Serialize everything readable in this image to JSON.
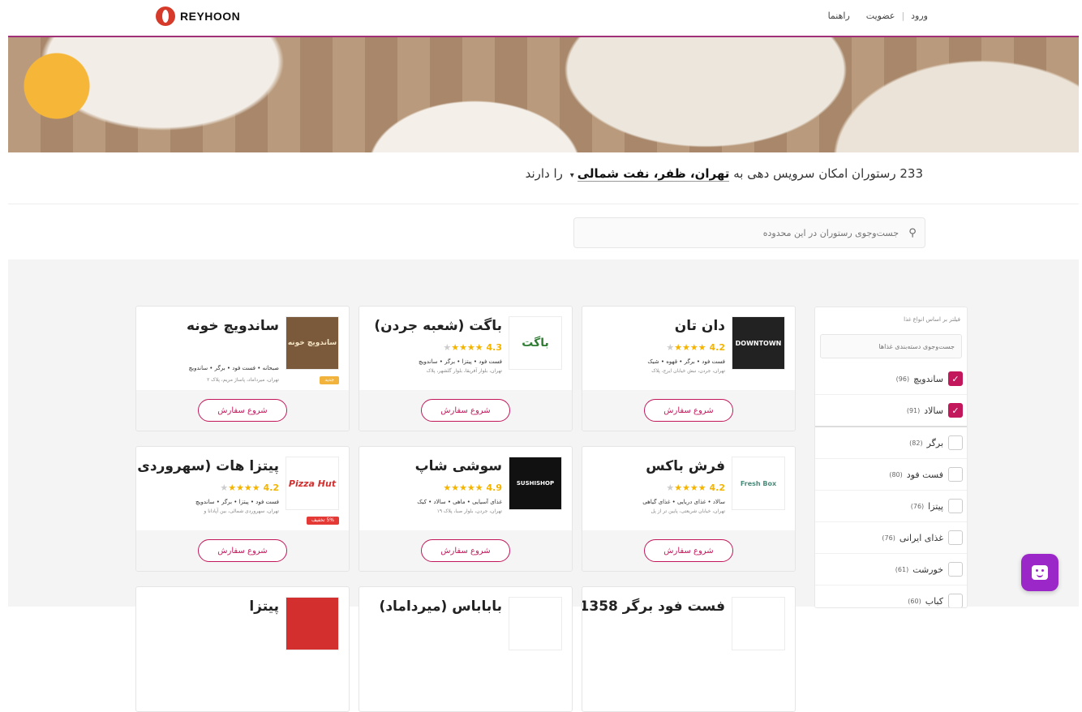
{
  "header": {
    "logo_text": "REYHOON",
    "nav": [
      {
        "label": "ورود"
      },
      {
        "label": "عضویت"
      },
      {
        "label": "راهنما"
      }
    ]
  },
  "summary": {
    "count": "233",
    "prefix": "رستوران امکان سرویس دهی به",
    "location": "تهران، ظفر، نفت شمالی",
    "suffix": "را دارند"
  },
  "search": {
    "placeholder": "جست‌وجوی رستوران در این محدوده"
  },
  "filter": {
    "title": "فیلتر بر اساس انواع غذا",
    "search_placeholder": "جست‌وجوی دسته‌بندی غذاها",
    "items": [
      {
        "label": "ساندویچ",
        "count": "(96)",
        "checked": true
      },
      {
        "label": "سالاد",
        "count": "(91)",
        "checked": true
      },
      {
        "label": "برگر",
        "count": "(82)",
        "checked": false
      },
      {
        "label": "فست فود",
        "count": "(80)",
        "checked": false
      },
      {
        "label": "پیتزا",
        "count": "(76)",
        "checked": false
      },
      {
        "label": "غذای ایرانی",
        "count": "(76)",
        "checked": false
      },
      {
        "label": "خورشت",
        "count": "(61)",
        "checked": false
      },
      {
        "label": "کباب",
        "count": "(60)",
        "checked": false
      }
    ]
  },
  "restaurants": [
    {
      "name": "دان تان",
      "rating": "4.2",
      "stars": 4,
      "tags": "فست فود • برگر • قهوه • شیک",
      "address": "تهران، جردن، نبش خیابان ایرج، پلاک",
      "logo": "DOWNTOWN",
      "badge": "",
      "button": "شروع سفارش"
    },
    {
      "name": "باگت (شعبه جردن)",
      "rating": "4.3",
      "stars": 4,
      "tags": "فست فود • پیتزا • برگر • ساندویچ",
      "address": "تهران، بلوار آفریقا، بلوار گلشهر، پلاک",
      "logo": "باگت",
      "badge": "",
      "button": "شروع سفارش"
    },
    {
      "name": "ساندویچ خونه",
      "rating": "",
      "stars": 0,
      "tags": "صبحانه • فست فود • برگر • ساندویچ",
      "address": "تهران، میرداماد، پاساژ مریم، پلاک ۲",
      "logo": "ساندویچ خونه",
      "badge": "جدید",
      "button": "شروع سفارش"
    },
    {
      "name": "فرش باکس",
      "rating": "4.2",
      "stars": 4,
      "tags": "سالاد • غذای دریایی • غذای گیاهی",
      "address": "تهران، خیابان شریعتی، پایین تر از پل",
      "logo": "Fresh Box",
      "badge": "",
      "button": "شروع سفارش"
    },
    {
      "name": "سوشی شاپ",
      "rating": "4.9",
      "stars": 5,
      "tags": "غذای آسیایی • ماهی • سالاد • کیک",
      "address": "تهران، جردن، بلوار صبا، پلاک ۱۹",
      "logo": "SUSHISHOP",
      "badge": "",
      "button": "شروع سفارش"
    },
    {
      "name": "پیتزا هات (سهروردی)",
      "rating": "4.2",
      "stars": 4,
      "tags": "فست فود • پیتزا • برگر • ساندویچ",
      "address": "تهران، سهروردی شمالی، بین آپادانا و",
      "logo": "Pizza Hut",
      "badge": "5% تخفیف",
      "button": "شروع سفارش"
    }
  ],
  "partial_cards": [
    {
      "name": "فست فود برگر 1358"
    },
    {
      "name": "باباباس (میرداماد)"
    },
    {
      "name": "پیتزا"
    }
  ],
  "colors": {
    "accent": "#c2185b",
    "star": "#f4b400",
    "chat": "#9b27c9"
  },
  "chat_icon": "chat-bot-icon"
}
